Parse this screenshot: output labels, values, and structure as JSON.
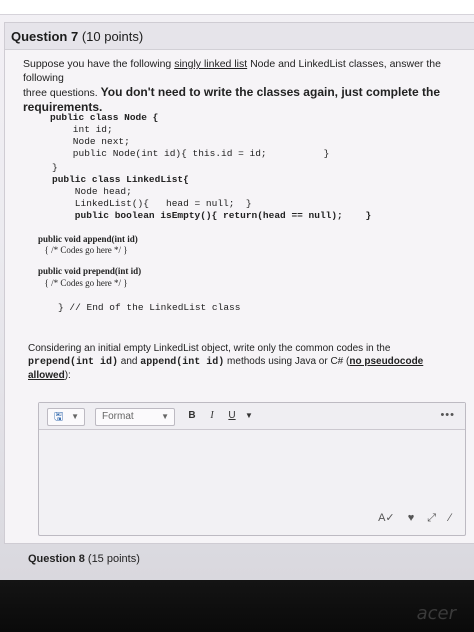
{
  "question": {
    "number_label": "Question 7",
    "points_label": "(10 points)",
    "prompt_line1": "Suppose you have the following ",
    "prompt_link": "singly linked list",
    "prompt_line1b": " Node and LinkedList classes, answer the following",
    "prompt_line2": "three questions. ",
    "prompt_bold": "You don't need to write the classes again, just complete the requirements."
  },
  "code_lines": {
    "l1": "public class Node {",
    "l2": "    int id;",
    "l3": "    Node next;",
    "l4": "    public Node(int id){ this.id = id;          }",
    "l5": "}",
    "l6": "public class LinkedList{",
    "l7": "    Node head;",
    "l8": "    LinkedList(){   head = null;  }",
    "l9": "    public boolean isEmpty(){ return(head == null);    }",
    "l10": "public void append(int id)",
    "l11": "  { /* Codes go here */ }",
    "l12": "public void prepend(int id)",
    "l13": "  { /* Codes go here */ }",
    "l14": "} // End of the LinkedList class"
  },
  "instruction": {
    "text1": "Considering an initial empty LinkedList object, write only the common codes in the",
    "mono1": "prepend(int id)",
    "and": " and ",
    "mono2": "append(int id)",
    "text2": " methods using Java or C# (",
    "underline": "no pseudocode allowed",
    "text3": "):"
  },
  "editor": {
    "format_label": "Format",
    "bold_label": "B",
    "italic_label": "I",
    "underline_label": "U",
    "more_label": "•••"
  },
  "next_question": {
    "number_label": "Question 8",
    "points_label": "(15 points)"
  },
  "brand": "acer"
}
